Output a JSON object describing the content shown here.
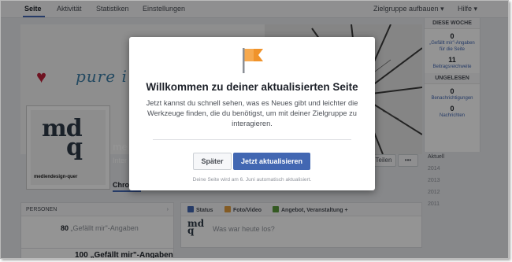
{
  "nav": {
    "tabs": [
      "Seite",
      "Aktivität",
      "Statistiken",
      "Einstellungen"
    ],
    "audience_label": "Zielgruppe aufbauen ▾",
    "help_label": "Hilfe ▾"
  },
  "cover": {
    "tagline": "pure i"
  },
  "profile": {
    "logo_caption": "mediendesign-quer",
    "name": "me",
    "category": "Inter",
    "share_label": "Teilen",
    "more_label": "•••",
    "chronicle_tab": "Chro"
  },
  "sidebar_stats": {
    "this_week_header": "DIESE WOCHE",
    "likes_count": "0",
    "likes_label": "„Gefällt mir\"-Angaben für die Seite",
    "reach_count": "11",
    "reach_label": "Beitragsreichweite",
    "unread_header": "UNGELESEN",
    "notif_count": "0",
    "notif_label": "Benachrichtigungen",
    "msg_count": "0",
    "msg_label": "Nachrichten"
  },
  "timeline_years": [
    "Aktuell",
    "2014",
    "2013",
    "2012",
    "2011"
  ],
  "persons": {
    "header": "PERSONEN",
    "likes_text": "80",
    "likes_suffix": "„Gefällt mir\"-Angaben",
    "likes_bottom": "100 „Gefällt mir\"-Angaben"
  },
  "composer": {
    "tab_status": "Status",
    "tab_photo": "Foto/Video",
    "tab_offer": "Angebot, Veranstaltung +",
    "placeholder": "Was war heute los?"
  },
  "modal": {
    "title": "Willkommen zu deiner aktualisierten Seite",
    "body": "Jetzt kannst du schnell sehen, was es Neues gibt und leichter die Werkzeuge finden, die du benötigst, um mit deiner Zielgruppe zu interagieren.",
    "later_button": "Später",
    "update_button": "Jetzt aktualisieren",
    "footer": "Deine Seite wird am 6. Juni automatisch aktualisiert."
  },
  "colors": {
    "brand_blue": "#4267b2",
    "flag_orange": "#f0932b",
    "overlay": "rgba(0,0,0,0.42)"
  }
}
